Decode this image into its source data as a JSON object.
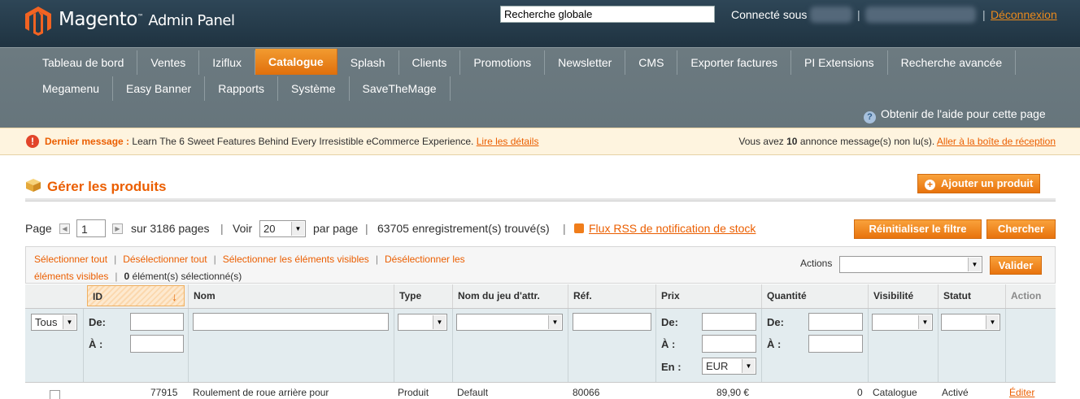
{
  "header": {
    "logo_text": "Magento",
    "logo_tm": "™",
    "logo_sub": "Admin Panel",
    "global_search_value": "Recherche globale",
    "logged_in_label": "Connecté sous",
    "separator": "|",
    "logout_label": "Déconnexion"
  },
  "nav": {
    "row1": [
      "Tableau de bord",
      "Ventes",
      "Iziflux",
      "Catalogue",
      "Splash",
      "Clients",
      "Promotions",
      "Newsletter",
      "CMS",
      "Exporter factures",
      "PI Extensions",
      "Recherche avancée"
    ],
    "row2": [
      "Megamenu",
      "Easy Banner",
      "Rapports",
      "Système",
      "SaveTheMage"
    ],
    "active": "Catalogue",
    "help_label": "Obtenir de l'aide pour cette page"
  },
  "message": {
    "icon": "!",
    "prefix": "Dernier message :",
    "text": "Learn The 6 Sweet Features Behind Every Irresistible eCommerce Experience.",
    "details_link": "Lire les détails",
    "unread_before": "Vous avez",
    "unread_count": "10",
    "unread_after": "annonce message(s) non lu(s).",
    "inbox_link": "Aller à la boîte de réception"
  },
  "page": {
    "title": "Gérer les produits",
    "add_product_button": "Ajouter un produit"
  },
  "pager": {
    "page_label": "Page",
    "current_page": "1",
    "total_pages_text": "sur 3186 pages",
    "sep": "|",
    "view_label": "Voir",
    "per_page_value": "20",
    "per_page_label": "par page",
    "records_text": "63705 enregistrement(s) trouvé(s)",
    "rss_link": "Flux RSS de notification de stock",
    "reset_filter_button": "Réinitialiser le filtre",
    "search_button": "Chercher"
  },
  "massaction": {
    "select_all": "Sélectionner tout",
    "unselect_all": "Désélectionner tout",
    "select_visible": "Sélectionner les éléments visibles",
    "unselect_visible_1": "Désélectionner les",
    "unselect_visible_2": "éléments visibles",
    "selected_count": "0",
    "selected_label": "élément(s) sélectionné(s)",
    "actions_label": "Actions",
    "submit_button": "Valider"
  },
  "grid": {
    "columns": [
      "ID",
      "Nom",
      "Type",
      "Nom du jeu d'attr.",
      "Réf.",
      "Prix",
      "Quantité",
      "Visibilité",
      "Statut",
      "Action"
    ],
    "filter": {
      "any_value": "Tous",
      "from_label": "De:",
      "to_label": "À :",
      "currency_label": "En :",
      "currency_value": "EUR"
    },
    "row1": {
      "id": "77915",
      "name": "Roulement de roue arrière pour",
      "type": "Produit",
      "attr_set": "Default",
      "sku": "80066",
      "price": "89,90 €",
      "qty": "0",
      "visibility": "Catalogue",
      "status": "Activé",
      "action": "Éditer"
    }
  },
  "colors": {
    "accent": "#eb5e00",
    "header_bg": "#2a3f4d",
    "nav_bg": "#6a787e"
  }
}
